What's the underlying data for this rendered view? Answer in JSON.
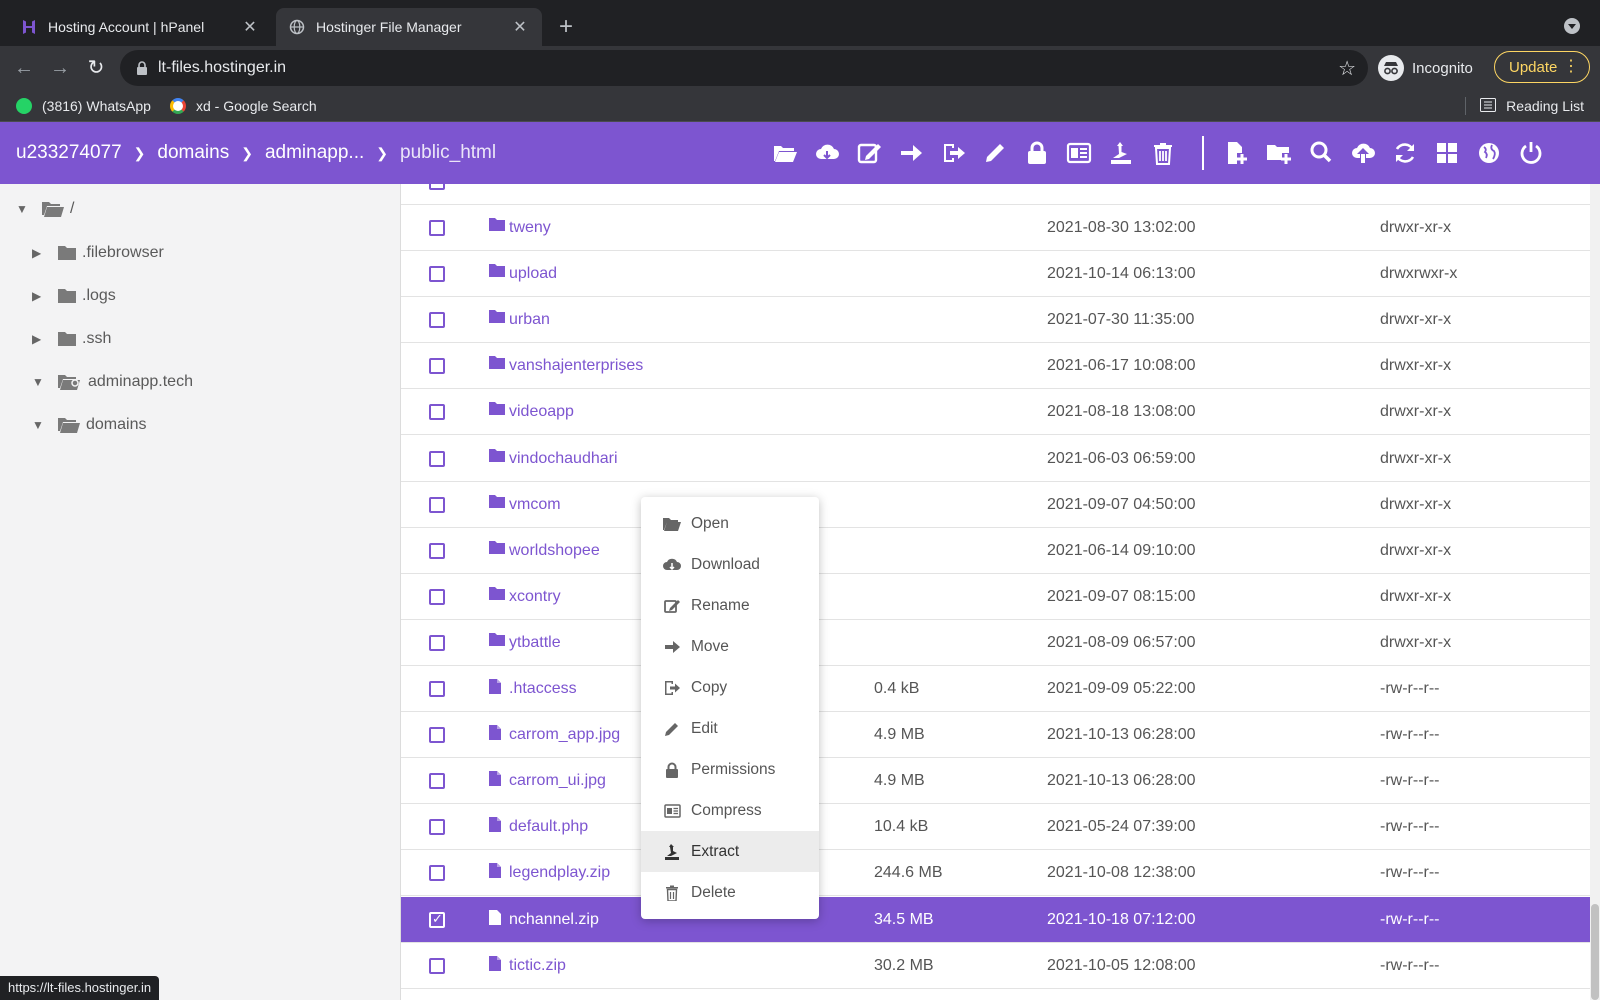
{
  "browser": {
    "tabs": [
      {
        "title": "Hosting Account | hPanel",
        "active": false
      },
      {
        "title": "Hostinger File Manager",
        "active": true
      }
    ],
    "url": "lt-files.hostinger.in",
    "profile": "Incognito",
    "update_label": "Update",
    "bookmarks": [
      {
        "label": "(3816) WhatsApp",
        "icon": "whatsapp-icon"
      },
      {
        "label": "xd - Google Search",
        "icon": "google-icon"
      }
    ],
    "reading_list": "Reading List",
    "status_url": "https://lt-files.hostinger.in"
  },
  "breadcrumb": [
    "u233274077",
    "domains",
    "adminapp...",
    "public_html"
  ],
  "toolbar_icons": [
    "open-icon",
    "download-icon",
    "rename-icon",
    "move-icon",
    "copy-icon",
    "edit-icon",
    "permissions-icon",
    "compress-icon",
    "extract-icon",
    "delete-icon",
    "new-file-icon",
    "new-folder-icon",
    "search-icon",
    "upload-icon",
    "refresh-icon",
    "grid-view-icon",
    "globe-icon",
    "logout-icon"
  ],
  "tree": [
    {
      "label": "/",
      "expanded": true
    },
    {
      "label": ".filebrowser",
      "expanded": false
    },
    {
      "label": ".logs",
      "expanded": false
    },
    {
      "label": ".ssh",
      "expanded": false
    },
    {
      "label": "adminapp.tech",
      "expanded": true
    },
    {
      "label": "domains",
      "expanded": true
    }
  ],
  "files": [
    {
      "name": "tweny",
      "type": "folder",
      "size": "",
      "date": "2021-08-30 13:02:00",
      "perm": "drwxr-xr-x",
      "selected": false
    },
    {
      "name": "upload",
      "type": "folder",
      "size": "",
      "date": "2021-10-14 06:13:00",
      "perm": "drwxrwxr-x",
      "selected": false
    },
    {
      "name": "urban",
      "type": "folder",
      "size": "",
      "date": "2021-07-30 11:35:00",
      "perm": "drwxr-xr-x",
      "selected": false
    },
    {
      "name": "vanshajenterprises",
      "type": "folder",
      "size": "",
      "date": "2021-06-17 10:08:00",
      "perm": "drwxr-xr-x",
      "selected": false
    },
    {
      "name": "videoapp",
      "type": "folder",
      "size": "",
      "date": "2021-08-18 13:08:00",
      "perm": "drwxr-xr-x",
      "selected": false
    },
    {
      "name": "vindochaudhari",
      "type": "folder",
      "size": "",
      "date": "2021-06-03 06:59:00",
      "perm": "drwxr-xr-x",
      "selected": false
    },
    {
      "name": "vmcom",
      "type": "folder",
      "size": "",
      "date": "2021-09-07 04:50:00",
      "perm": "drwxr-xr-x",
      "selected": false
    },
    {
      "name": "worldshopee",
      "type": "folder",
      "size": "",
      "date": "2021-06-14 09:10:00",
      "perm": "drwxr-xr-x",
      "selected": false
    },
    {
      "name": "xcontry",
      "type": "folder",
      "size": "",
      "date": "2021-09-07 08:15:00",
      "perm": "drwxr-xr-x",
      "selected": false
    },
    {
      "name": "ytbattle",
      "type": "folder",
      "size": "",
      "date": "2021-08-09 06:57:00",
      "perm": "drwxr-xr-x",
      "selected": false
    },
    {
      "name": ".htaccess",
      "type": "file",
      "size": "0.4 kB",
      "date": "2021-09-09 05:22:00",
      "perm": "-rw-r--r--",
      "selected": false
    },
    {
      "name": "carrom_app.jpg",
      "type": "file",
      "size": "4.9 MB",
      "date": "2021-10-13 06:28:00",
      "perm": "-rw-r--r--",
      "selected": false
    },
    {
      "name": "carrom_ui.jpg",
      "type": "file",
      "size": "4.9 MB",
      "date": "2021-10-13 06:28:00",
      "perm": "-rw-r--r--",
      "selected": false
    },
    {
      "name": "default.php",
      "type": "file",
      "size": "10.4 kB",
      "date": "2021-05-24 07:39:00",
      "perm": "-rw-r--r--",
      "selected": false
    },
    {
      "name": "legendplay.zip",
      "type": "file",
      "size": "244.6 MB",
      "date": "2021-10-08 12:38:00",
      "perm": "-rw-r--r--",
      "selected": false
    },
    {
      "name": "nchannel.zip",
      "type": "file",
      "size": "34.5 MB",
      "date": "2021-10-18 07:12:00",
      "perm": "-rw-r--r--",
      "selected": true
    },
    {
      "name": "tictic.zip",
      "type": "file",
      "size": "30.2 MB",
      "date": "2021-10-05 12:08:00",
      "perm": "-rw-r--r--",
      "selected": false
    }
  ],
  "context_menu": [
    {
      "label": "Open",
      "icon": "folder-open-icon"
    },
    {
      "label": "Download",
      "icon": "cloud-download-icon"
    },
    {
      "label": "Rename",
      "icon": "rename-icon"
    },
    {
      "label": "Move",
      "icon": "arrow-right-icon"
    },
    {
      "label": "Copy",
      "icon": "copy-icon"
    },
    {
      "label": "Edit",
      "icon": "pencil-icon"
    },
    {
      "label": "Permissions",
      "icon": "lock-icon"
    },
    {
      "label": "Compress",
      "icon": "compress-icon"
    },
    {
      "label": "Extract",
      "icon": "extract-icon",
      "highlighted": true
    },
    {
      "label": "Delete",
      "icon": "trash-icon"
    }
  ],
  "colors": {
    "accent": "#7d55d0",
    "chrome_dark": "#202124",
    "chrome_mid": "#35363a",
    "update": "#fdd663"
  }
}
